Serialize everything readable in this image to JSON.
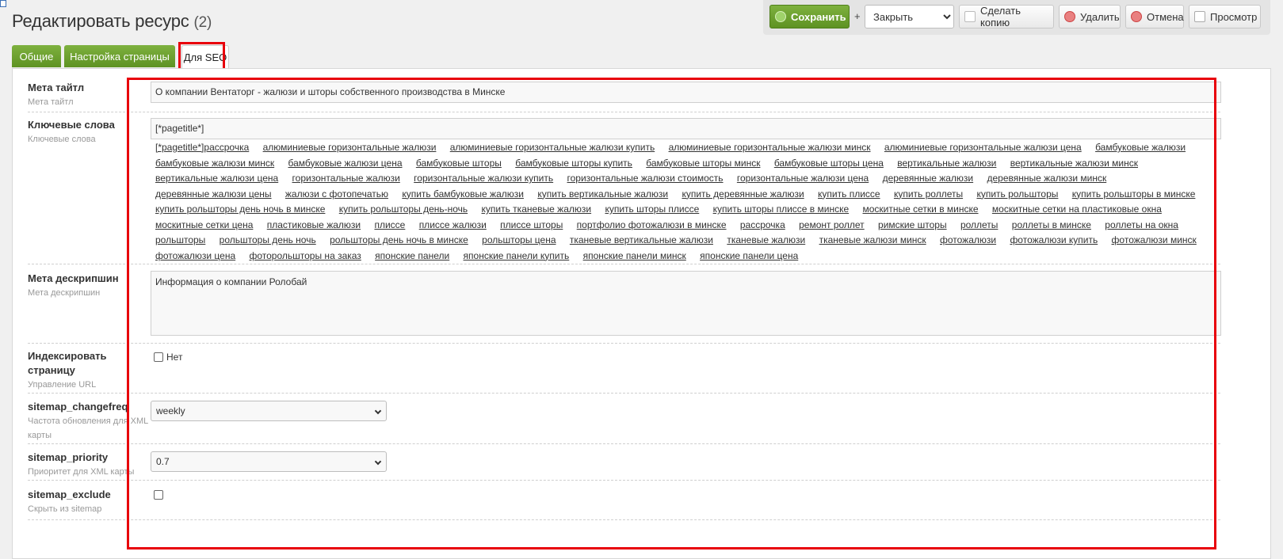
{
  "page": {
    "title": "Редактировать ресурс",
    "count": "(2)"
  },
  "toolbar": {
    "save_label": "Сохранить",
    "plus": "+",
    "close_select_value": "Закрыть",
    "copy_label": "Сделать копию",
    "delete_label": "Удалить",
    "cancel_label": "Отмена",
    "preview_label": "Просмотр"
  },
  "tabs": [
    {
      "label": "Общие"
    },
    {
      "label": "Настройка страницы"
    },
    {
      "label": "Для SEO"
    }
  ],
  "fields": {
    "meta_title": {
      "label": "Мета тайтл",
      "desc": "Мета тайтл",
      "value": "О компании Вентаторг - жалюзи и шторы собственного производства в Минске"
    },
    "keywords": {
      "label": "Ключевые слова",
      "desc": "Ключевые слова",
      "value": "[*pagetitle*]",
      "first_tag": "[*pagetitle*]",
      "tags": [
        "рассрочка",
        "алюминиевые горизонтальные жалюзи",
        "алюминиевые горизонтальные жалюзи купить",
        "алюминиевые горизонтальные жалюзи минск",
        "алюминиевые горизонтальные жалюзи цена",
        "бамбуковые жалюзи",
        "бамбуковые жалюзи минск",
        "бамбуковые жалюзи цена",
        "бамбуковые шторы",
        "бамбуковые шторы купить",
        "бамбуковые шторы минск",
        "бамбуковые шторы цена",
        "вертикальные жалюзи",
        "вертикальные жалюзи минск",
        "вертикальные жалюзи цена",
        "горизонтальные жалюзи",
        "горизонтальные жалюзи купить",
        "горизонтальные жалюзи стоимость",
        "горизонтальные жалюзи цена",
        "деревянные жалюзи",
        "деревянные жалюзи минск",
        "деревянные жалюзи цены",
        "жалюзи с фотопечатью",
        "купить бамбуковые жалюзи",
        "купить вертикальные жалюзи",
        "купить деревянные жалюзи",
        "купить плиссе",
        "купить роллеты",
        "купить рольшторы",
        "купить рольшторы в минске",
        "купить рольшторы день ночь в минске",
        "купить рольшторы день-ночь",
        "купить тканевые жалюзи",
        "купить шторы плиссе",
        "купить шторы плиссе в минске",
        "москитные сетки в минске",
        "москитные сетки на пластиковые окна",
        "москитные сетки цена",
        "пластиковые жалюзи",
        "плиссе",
        "плиссе жалюзи",
        "плиссе шторы",
        "портфолио фотожалюзи в минске",
        "рассрочка",
        "ремонт роллет",
        "римские шторы",
        "роллеты",
        "роллеты в минске",
        "роллеты на окна",
        "рольшторы",
        "рольшторы день ночь",
        "рольшторы день ночь в минске",
        "рольшторы цена",
        "тканевые вертикальные жалюзи",
        "тканевые жалюзи",
        "тканевые жалюзи минск",
        "фотожалюзи",
        "фотожалюзи купить",
        "фотожалюзи минск",
        "фотожалюзи цена",
        "фоторольшторы на заказ",
        "японские панели",
        "японские панели купить",
        "японские панели минск",
        "японские панели цена"
      ]
    },
    "meta_description": {
      "label": "Мета дескрипшин",
      "desc": "Мета дескрипшин",
      "value": "Информация о компании Ролобай"
    },
    "index_page": {
      "label_line1": "Индексировать",
      "label_line2": "страницу",
      "desc": "Управление URL",
      "checkbox_label": "Нет"
    },
    "sitemap_changefreq": {
      "label": "sitemap_changefreq",
      "desc_line1": "Частота обновления для XML",
      "desc_line2": "карты",
      "value": "weekly"
    },
    "sitemap_priority": {
      "label": "sitemap_priority",
      "desc": "Приоритет для XML карты",
      "value": "0.7"
    },
    "sitemap_exclude": {
      "label": "sitemap_exclude",
      "desc": "Скрыть из sitemap"
    }
  },
  "colors": {
    "accent_green": "#6aa02c",
    "highlight_red": "#e8000b"
  }
}
